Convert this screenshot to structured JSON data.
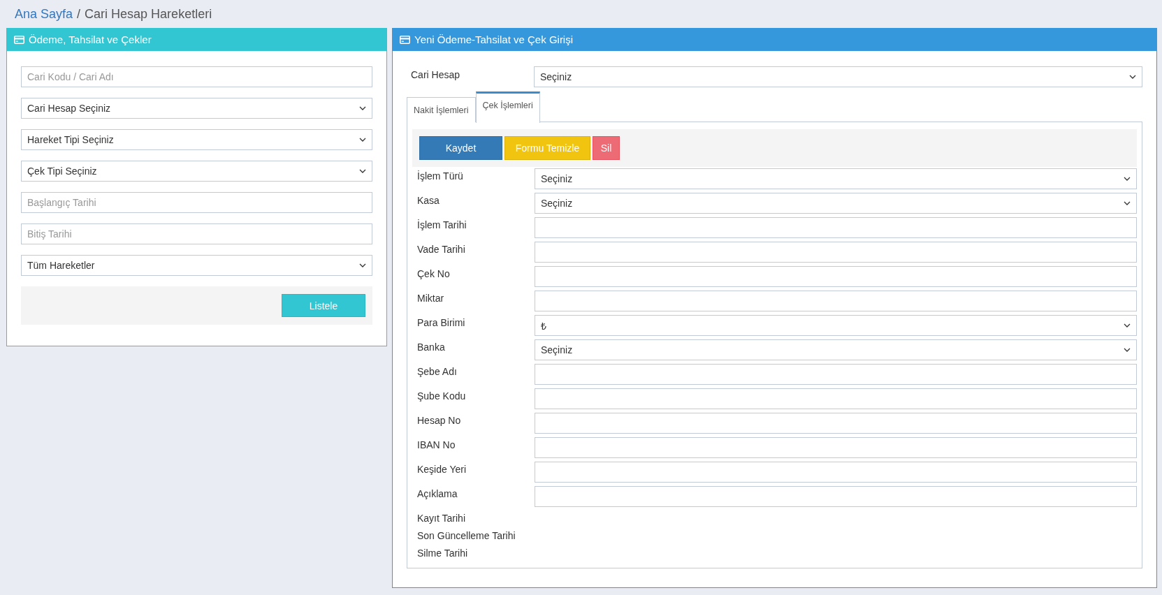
{
  "breadcrumb": {
    "link": "Ana Sayfa",
    "separator": "/",
    "current": "Cari Hesap Hareketleri"
  },
  "left_panel": {
    "title": "Ödeme, Tahsilat ve Çekler",
    "filters": [
      {
        "kind": "input",
        "placeholder": "Cari Kodu / Cari Adı"
      },
      {
        "kind": "select",
        "value": "Cari Hesap Seçiniz"
      },
      {
        "kind": "select",
        "value": "Hareket Tipi Seçiniz"
      },
      {
        "kind": "select",
        "value": "Çek Tipi Seçiniz"
      },
      {
        "kind": "input",
        "placeholder": "Başlangıç Tarihi"
      },
      {
        "kind": "input",
        "placeholder": "Bitiş Tarihi"
      },
      {
        "kind": "select",
        "value": "Tüm Hareketler"
      }
    ],
    "button": "Listele"
  },
  "right_panel": {
    "title": "Yeni Ödeme-Tahsilat ve Çek Girişi",
    "account": {
      "label": "Cari Hesap",
      "value": "Seçiniz"
    },
    "tabs": [
      {
        "label": "Nakit İşlemleri",
        "selected": false
      },
      {
        "label": "Çek İşlemleri",
        "selected": true
      }
    ],
    "actions": [
      {
        "label": "Kaydet",
        "kind": "primary"
      },
      {
        "label": "Formu Temizle",
        "kind": "warning"
      },
      {
        "label": "Sil",
        "kind": "danger"
      }
    ],
    "fields": [
      {
        "label": "İşlem Türü",
        "kind": "select",
        "value": "Seçiniz"
      },
      {
        "label": "Kasa",
        "kind": "select",
        "value": "Seçiniz"
      },
      {
        "label": "İşlem Tarihi",
        "kind": "input"
      },
      {
        "label": "Vade Tarihi",
        "kind": "input"
      },
      {
        "label": "Çek No",
        "kind": "input"
      },
      {
        "label": "Miktar",
        "kind": "input"
      },
      {
        "label": "Para Birimi",
        "kind": "select",
        "value": "₺"
      },
      {
        "label": "Banka",
        "kind": "select",
        "value": "Seçiniz"
      },
      {
        "label": "Şebe Adı",
        "kind": "input"
      },
      {
        "label": "Şube Kodu",
        "kind": "input"
      },
      {
        "label": "Hesap No",
        "kind": "input"
      },
      {
        "label": "IBAN No",
        "kind": "input"
      },
      {
        "label": "Keşide Yeri",
        "kind": "input"
      },
      {
        "label": "Açıklama",
        "kind": "input"
      },
      {
        "label": "Kayıt Tarihi",
        "kind": "info"
      },
      {
        "label": "Son Güncelleme Tarihi",
        "kind": "info"
      },
      {
        "label": "Silme Tarihi",
        "kind": "info"
      }
    ]
  }
}
